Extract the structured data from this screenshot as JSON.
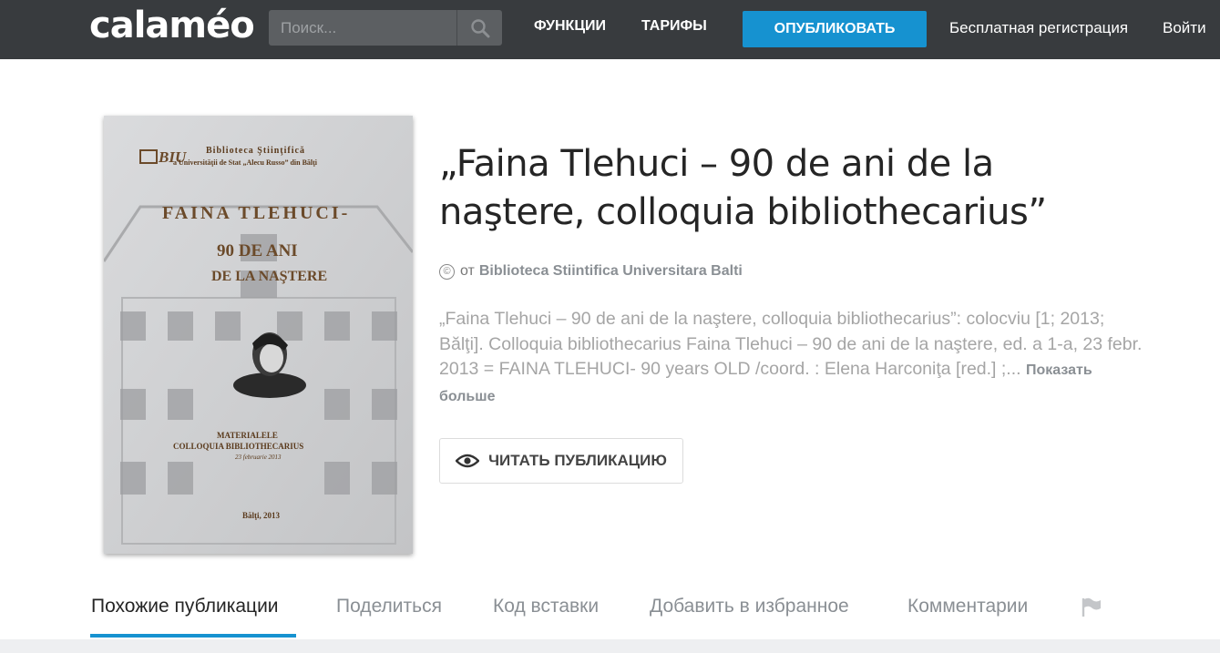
{
  "header": {
    "logo": "calaméo",
    "search_placeholder": "Поиск...",
    "nav": [
      "ФУНКЦИИ",
      "ТАРИФЫ"
    ],
    "publish_label": "ОПУБЛИКОВАТЬ",
    "register_label": "Бесплатная регистрация",
    "login_label": "Войти"
  },
  "cover": {
    "library_line1": "Biblioteca Ştiinţifică",
    "library_line2": "a Universităţii de Stat „Alecu Russo” din Bălţi",
    "logo_text": "BIU",
    "name": "FAINA TLEHUCI-",
    "years": "90 DE ANI",
    "subtitle": "DE LA NAŞTERE",
    "materials_line1": "MATERIALELE",
    "materials_line2": "COLLOQUIA BIBLIOTHECARIUS",
    "date_line": "23 februarie 2013",
    "place_year": "Bălţi, 2013"
  },
  "publication": {
    "title": "„Faina Tlehuci – 90 de ani de la naştere, colloquia bibliothecarius”",
    "by_label": "от",
    "author": "Biblioteca Stiintifica Universitara Balti",
    "description": "„Faina Tlehuci – 90 de ani de la naştere, colloquia bibliothecarius”: colocviu [1; 2013; Bălţi]. Colloquia bibliothecarius Faina Tlehuci – 90 de ani de la naştere, ed. a 1-a, 23 febr. 2013 = FAINA TLEHUCI- 90 years OLD /coord. : Elena Harconiţa [red.] ;...",
    "show_more": "Показать больше",
    "read_label": "ЧИТАТЬ ПУБЛИКАЦИЮ"
  },
  "tabs": [
    {
      "label": "Похожие публикации",
      "active": true
    },
    {
      "label": "Поделиться",
      "active": false
    },
    {
      "label": "Код вставки",
      "active": false
    },
    {
      "label": "Добавить в избранное",
      "active": false
    },
    {
      "label": "Комментарии",
      "active": false
    }
  ],
  "colors": {
    "header_bg": "#383b3e",
    "accent": "#1692d0"
  },
  "icons": [
    "search-icon",
    "copyright-icon",
    "eye-icon",
    "flag-icon"
  ]
}
